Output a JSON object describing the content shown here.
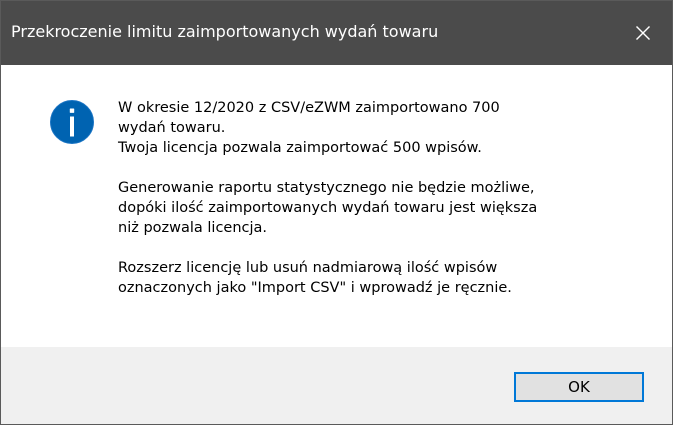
{
  "window": {
    "title": "Przekroczenie limitu zaimportowanych wydań towaru"
  },
  "message": {
    "paragraphs": [
      [
        "W okresie 12/2020 z CSV/eZWM zaimportowano 700",
        "wydań towaru.",
        "Twoja licencja pozwala zaimportować 500 wpisów."
      ],
      [
        "Generowanie raportu statystycznego nie będzie możliwe,",
        "dopóki ilość zaimportowanych wydań towaru jest większa",
        "niż pozwala licencja."
      ],
      [
        "Rozszerz licencję lub usuń nadmiarową ilość wpisów",
        "oznaczonych jako \"Import CSV\" i wprowadź je ręcznie."
      ]
    ]
  },
  "buttons": {
    "ok_label": "OK"
  },
  "icons": {
    "close": "close-icon",
    "info": "info-icon"
  },
  "colors": {
    "titlebar": "#4b4b4b",
    "info_circle": "#0063b1",
    "button_focus_border": "#0078d7",
    "footer": "#f0f0f0"
  }
}
